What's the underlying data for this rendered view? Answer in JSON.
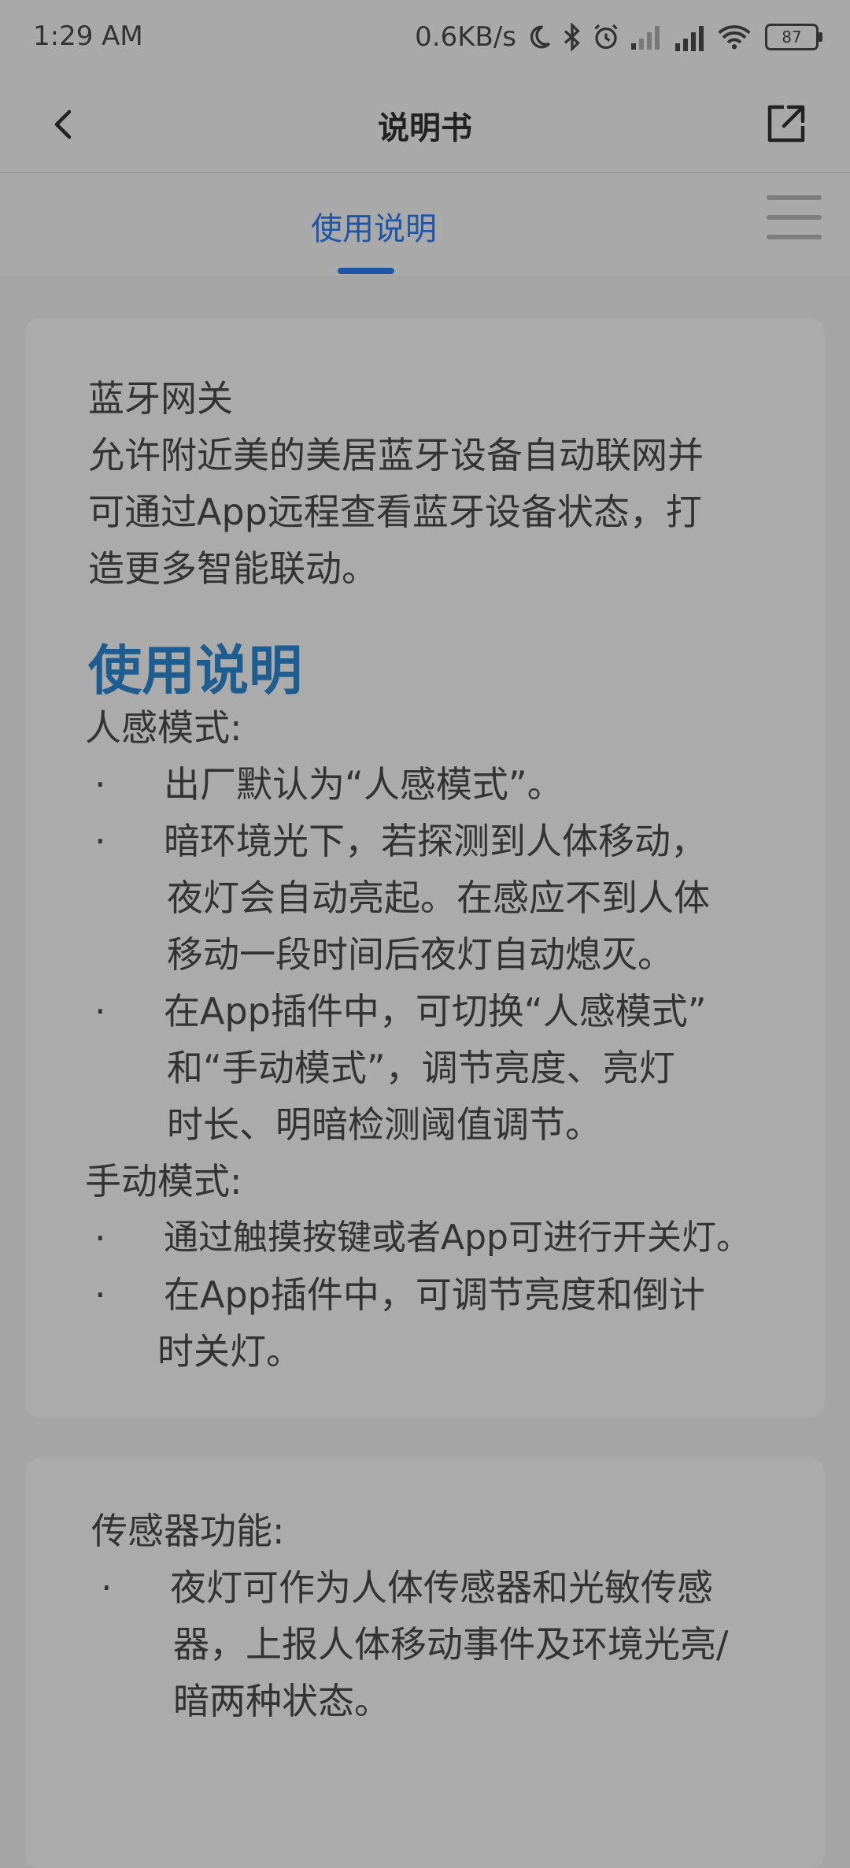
{
  "status_bar": {
    "time": "1:29 AM",
    "speed": "0.6KB/s",
    "battery": "87"
  },
  "nav": {
    "title": "说明书",
    "back_icon": "chevron-left-icon",
    "share_icon": "external-link-icon"
  },
  "tabs": {
    "active_label": "使用说明",
    "menu_icon": "hamburger-menu-icon"
  },
  "card1": {
    "section_title": "蓝牙网关",
    "intro_lines": [
      "允许附近美的美居蓝牙设备自动联网并",
      "可通过App远程查看蓝牙设备状态，打",
      "造更多智能联动。"
    ],
    "heading": "使用说明",
    "mode1_title": "人感模式:",
    "mode1_bullets": [
      [
        "出厂默认为“人感模式”。"
      ],
      [
        "暗环境光下，若探测到人体移动，",
        "夜灯会自动亮起。在感应不到人体",
        "移动一段时间后夜灯自动熄灭。"
      ],
      [
        "在App插件中，可切换“人感模式”",
        "和“手动模式”，调节亮度、亮灯",
        "时长、明暗检测阈值调节。"
      ]
    ],
    "mode2_title": "手动模式:",
    "mode2_bullets": [
      [
        "通过触摸按键或者App可进行开关灯。"
      ],
      [
        "在App插件中，可调节亮度和倒计",
        "时关灯。"
      ]
    ]
  },
  "card2": {
    "title": "传感器功能:",
    "bullets": [
      [
        "夜灯可作为人体传感器和光敏传感",
        "器，上报人体移动事件及环境光亮/",
        "暗两种状态。"
      ]
    ]
  },
  "bullet_char": "·"
}
